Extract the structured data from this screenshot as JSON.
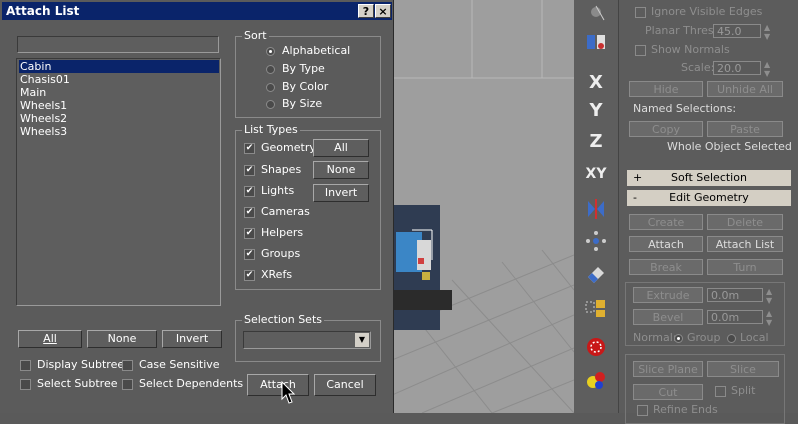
{
  "dialog": {
    "title": "Attach List",
    "help_label": "?",
    "close_label": "×",
    "search_value": "",
    "objects": [
      "Cabin",
      "Chasis01",
      "Main",
      "Wheels1",
      "Wheels2",
      "Wheels3"
    ],
    "selected_index": 0,
    "sort": {
      "label": "Sort",
      "options": [
        "Alphabetical",
        "By Type",
        "By Color",
        "By Size"
      ],
      "selected": "Alphabetical"
    },
    "list_types": {
      "label": "List Types",
      "items": [
        "Geometry",
        "Shapes",
        "Lights",
        "Cameras",
        "Helpers",
        "Groups",
        "XRefs"
      ],
      "all_label": "All",
      "none_label": "None",
      "invert_label": "Invert"
    },
    "selection_sets": {
      "label": "Selection Sets",
      "value": ""
    },
    "bottom_all": "All",
    "bottom_none": "None",
    "bottom_invert": "Invert",
    "display_subtree": "Display Subtree",
    "case_sensitive": "Case Sensitive",
    "select_subtree": "Select Subtree",
    "select_dependents": "Select Dependents",
    "attach_label": "Attach",
    "cancel_label": "Cancel"
  },
  "toolbar": {
    "x_label": "X",
    "y_label": "Y",
    "z_label": "Z",
    "xy_label": "XY"
  },
  "panel": {
    "ignore_visible_edges": "Ignore Visible Edges",
    "planar_thresh_label": "Planar Thresh:",
    "planar_thresh_value": "45.0",
    "show_normals": "Show Normals",
    "scale_label": "Scale:",
    "scale_value": "20.0",
    "hide_label": "Hide",
    "unhide_all_label": "Unhide All",
    "named_selections": "Named Selections:",
    "copy_label": "Copy",
    "paste_label": "Paste",
    "whole_object_selected": "Whole Object Selected",
    "soft_selection": {
      "sign": "+",
      "title": "Soft Selection"
    },
    "edit_geometry": {
      "sign": "-",
      "title": "Edit Geometry"
    },
    "create_label": "Create",
    "delete_label": "Delete",
    "attach_label": "Attach",
    "attach_list_label": "Attach List",
    "break_label": "Break",
    "turn_label": "Turn",
    "extrude_label": "Extrude",
    "extrude_value": "0.0m",
    "bevel_label": "Bevel",
    "bevel_value": "0.0m",
    "normal_label": "Normal:",
    "group_label": "Group",
    "local_label": "Local",
    "slice_plane_label": "Slice Plane",
    "slice_label": "Slice",
    "cut_label": "Cut",
    "split_label": "Split",
    "refine_ends_label": "Refine Ends"
  },
  "colors": {
    "titlebar": "#0a246a",
    "selection": "#0a246a",
    "rollout": "#d4cfc4"
  }
}
